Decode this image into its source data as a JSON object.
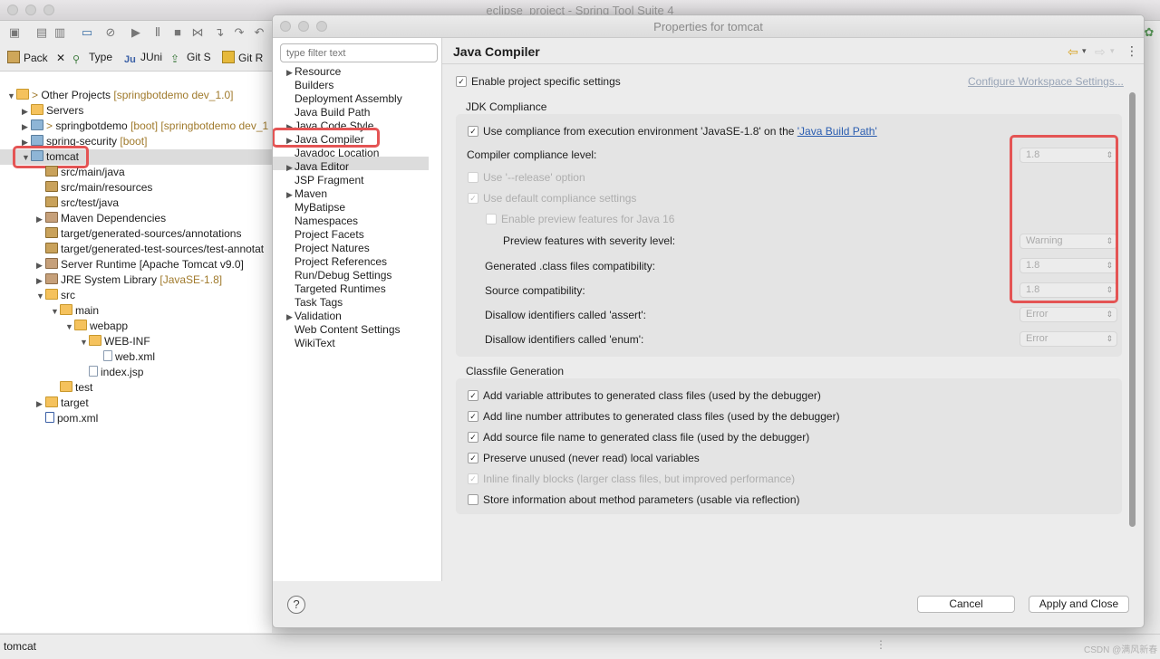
{
  "main_window": {
    "title": "eclipse_project - Spring Tool Suite 4"
  },
  "views_tabs": [
    {
      "label": "Pack",
      "icon": "package-explorer-icon"
    },
    {
      "label": "Type",
      "icon": "type-hierarchy-icon"
    },
    {
      "label": "JUni",
      "icon": "junit-icon"
    },
    {
      "label": "Git S",
      "icon": "git-staging-icon"
    },
    {
      "label": "Git R",
      "icon": "git-repositories-icon"
    }
  ],
  "tree": {
    "other_projects": "Other Projects",
    "other_projects_deco": "[springbotdemo dev_1.0]",
    "servers": "Servers",
    "springbotdemo": "springbotdemo",
    "springbotdemo_deco": "[boot] [springbotdemo dev_1",
    "spring_security": "spring-security",
    "spring_security_deco": "[boot]",
    "tomcat": "tomcat",
    "src_main_java": "src/main/java",
    "src_main_resources": "src/main/resources",
    "src_test_java": "src/test/java",
    "maven_dependencies": "Maven Dependencies",
    "target_gen_sources": "target/generated-sources/annotations",
    "target_gen_test_sources": "target/generated-test-sources/test-annotat",
    "server_runtime": "Server Runtime [Apache Tomcat v9.0]",
    "jre_library": "JRE System Library",
    "jre_library_deco": "[JavaSE-1.8]",
    "src": "src",
    "main": "main",
    "webapp": "webapp",
    "web_inf": "WEB-INF",
    "web_xml": "web.xml",
    "index_jsp": "index.jsp",
    "test": "test",
    "target": "target",
    "pom_xml": "pom.xml"
  },
  "status_bar": {
    "selection": "tomcat",
    "watermark": "CSDN @满风新春"
  },
  "dialog": {
    "title": "Properties for tomcat",
    "filter_placeholder": "type filter text",
    "nav_items": [
      "Resource",
      "Builders",
      "Deployment Assembly",
      "Java Build Path",
      "Java Code Style",
      "Java Compiler",
      "Javadoc Location",
      "Java Editor",
      "JSP Fragment",
      "Maven",
      "MyBatipse",
      "Namespaces",
      "Project Facets",
      "Project Natures",
      "Project References",
      "Run/Debug Settings",
      "Targeted Runtimes",
      "Task Tags",
      "Validation",
      "Web Content Settings",
      "WikiText"
    ],
    "selected_nav": "Java Compiler",
    "page_title": "Java Compiler",
    "enable_project_specific": "Enable project specific settings",
    "configure_workspace": "Configure Workspace Settings...",
    "jdk_compliance": {
      "heading": "JDK Compliance",
      "use_compliance_prefix": "Use compliance from execution environment 'JavaSE-1.8' on the ",
      "java_build_path_link": "'Java Build Path'",
      "compiler_compliance_level": "Compiler compliance level:",
      "compiler_compliance_value": "1.8",
      "use_release_option": "Use '--release' option",
      "use_default_compliance": "Use default compliance settings",
      "enable_preview": "Enable preview features for Java 16",
      "preview_severity": "Preview features with severity level:",
      "preview_severity_value": "Warning",
      "generated_class_compat": "Generated .class files compatibility:",
      "generated_class_compat_value": "1.8",
      "source_compat": "Source compatibility:",
      "source_compat_value": "1.8",
      "disallow_assert": "Disallow identifiers called 'assert':",
      "disallow_assert_value": "Error",
      "disallow_enum": "Disallow identifiers called 'enum':",
      "disallow_enum_value": "Error"
    },
    "classfile": {
      "heading": "Classfile Generation",
      "add_variable": "Add variable attributes to generated class files (used by the debugger)",
      "add_line_number": "Add line number attributes to generated class files (used by the debugger)",
      "add_source_file": "Add source file name to generated class file (used by the debugger)",
      "preserve_unused": "Preserve unused (never read) local variables",
      "inline_finally": "Inline finally blocks (larger class files, but improved performance)",
      "store_method_params": "Store information about method parameters (usable via reflection)"
    },
    "help_icon": "?",
    "cancel_button": "Cancel",
    "apply_close_button": "Apply and Close"
  }
}
